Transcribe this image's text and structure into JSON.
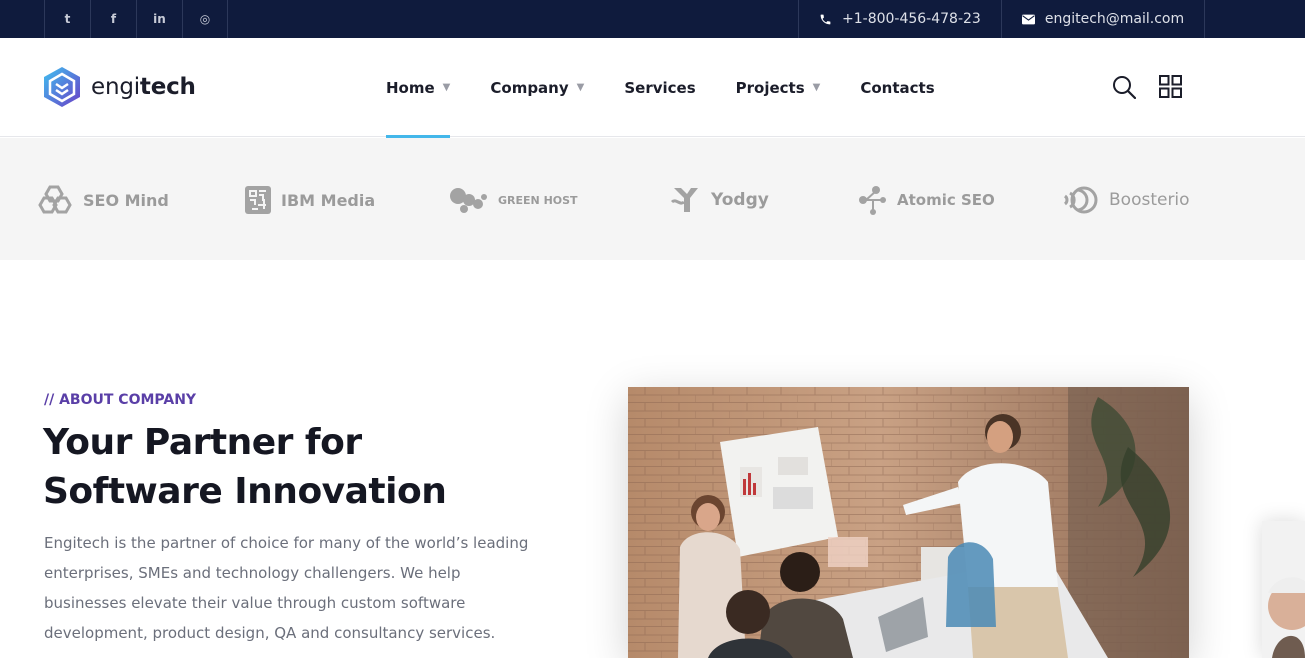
{
  "topbar": {
    "social": [
      {
        "icon": "twitter-icon",
        "label": "t"
      },
      {
        "icon": "facebook-icon",
        "label": "f"
      },
      {
        "icon": "linkedin-icon",
        "label": "in"
      },
      {
        "icon": "instagram-icon",
        "label": "◎"
      }
    ],
    "phone": "+1-800-456-478-23",
    "email": "engitech@mail.com"
  },
  "header": {
    "logo_prefix": "engi",
    "logo_suffix": "tech",
    "nav": [
      {
        "label": "Home",
        "has_dropdown": true,
        "active": true
      },
      {
        "label": "Company",
        "has_dropdown": true,
        "active": false
      },
      {
        "label": "Services",
        "has_dropdown": false,
        "active": false
      },
      {
        "label": "Projects",
        "has_dropdown": true,
        "active": false
      },
      {
        "label": "Contacts",
        "has_dropdown": false,
        "active": false
      }
    ],
    "caret": "▼",
    "icons": [
      "search-icon",
      "grid-menu-icon"
    ]
  },
  "partners": [
    {
      "name": "SEO Mind",
      "icon": "hexagon-logo-icon"
    },
    {
      "name": "IBM Media",
      "icon": "circuit-logo-icon"
    },
    {
      "name": "GREEN HOST",
      "icon": "splash-logo-icon"
    },
    {
      "name": "Yodgy",
      "icon": "y-logo-icon"
    },
    {
      "name": "Atomic SEO",
      "icon": "nodes-logo-icon"
    },
    {
      "name": "Boosterio",
      "icon": "waves-logo-icon"
    }
  ],
  "about": {
    "tagline": "// ABOUT COMPANY",
    "title_line1": "Your Partner for",
    "title_line2": "Software Innovation",
    "text": "Engitech is the partner of choice for many of the world’s leading enterprises, SMEs and technology challengers. We help businesses elevate their value through custom software development, product design, QA and consultancy services."
  },
  "colors": {
    "topbar_bg": "#0f1b3d",
    "accent_blue": "#43b7ea",
    "tagline_purple": "#5a3fa7",
    "partners_bg": "#f5f5f5"
  }
}
